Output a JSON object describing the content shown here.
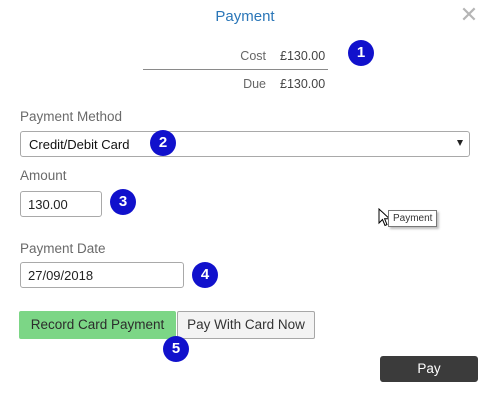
{
  "dialog": {
    "title": "Payment",
    "close_icon": "close-icon"
  },
  "summary": {
    "cost_label": "Cost",
    "cost_value": "£130.00",
    "due_label": "Due",
    "due_value": "£130.00"
  },
  "payment_method": {
    "label": "Payment Method",
    "selected": "Credit/Debit Card"
  },
  "amount": {
    "label": "Amount",
    "value": "130.00"
  },
  "payment_date": {
    "label": "Payment Date",
    "value": "27/09/2018"
  },
  "buttons": {
    "record": "Record Card Payment",
    "pay_now": "Pay With Card Now",
    "pay": "Pay"
  },
  "tooltip": "Payment",
  "badges": [
    "1",
    "2",
    "3",
    "4",
    "5"
  ],
  "colors": {
    "title": "#2a76b8",
    "badge": "#1111cc",
    "record_button": "#7cd686",
    "pay_button": "#3b3b3b"
  }
}
